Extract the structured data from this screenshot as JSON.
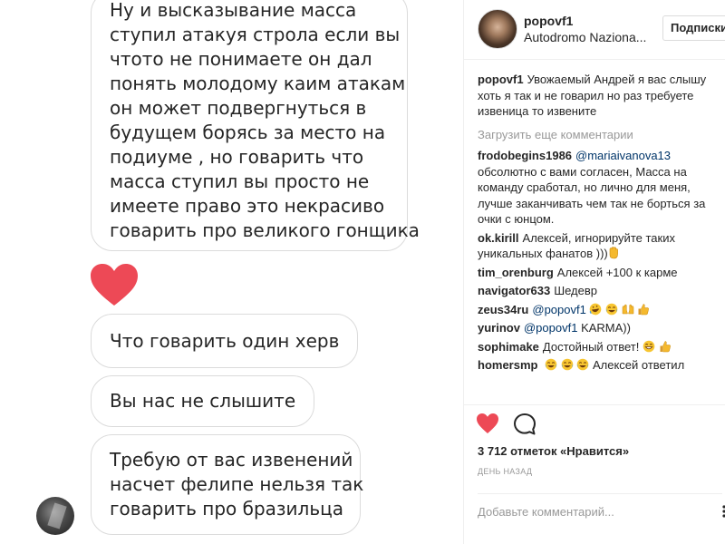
{
  "dm": {
    "message_1": [
      "Ну и высказывание масса",
      "ступил атакуя строла если вы",
      "чтото не понимаете он дал",
      "понять молодому каим атакам",
      "он может подвергнуться в",
      "будущем борясь за место на",
      "подиуме , но говарить что",
      "масса ступил вы просто не",
      "имеете право это некрасиво",
      "говарить про великого гонщика"
    ],
    "message_2": "Что говарить один херв",
    "message_3": "Вы нас не слышите",
    "message_4": [
      "Требую от вас извенений",
      "насчет фелипе нельзя так",
      "говарить про бразильца"
    ],
    "heart_color": "#ed4956"
  },
  "post": {
    "author": "popovf1",
    "location": "Autodromo Naziona...",
    "follow_label": "Подписки",
    "caption": {
      "user": "popovf1",
      "text": "Увожаемый Андрей я вас слышу хоть я так и не говарил но раз требуете извеница то извените"
    },
    "load_more": "Загрузить еще комментарии",
    "comments": [
      {
        "user": "frodobegins1986",
        "mention": "@mariaivanova13",
        "text": "обсолютно с вами согласен, Масса на команду сработал, но лично для меня, лучше заканчивать чем так не борться за очки с юнцом."
      },
      {
        "user": "ok.kirill",
        "text": "Алексей, игнорируйте таких уникальных фанатов )))",
        "emojis": [
          "raised-hand-emoji"
        ]
      },
      {
        "user": "tim_orenburg",
        "text": "Алексей +100 к карме"
      },
      {
        "user": "navigator633",
        "text": "Шедевр"
      },
      {
        "user": "zeus34ru",
        "mention": "@popovf1",
        "text": "",
        "emojis": [
          "rofl-emoji",
          "tears-of-joy-emoji",
          "raising-hands-emoji",
          "thumbs-up-emoji"
        ]
      },
      {
        "user": "yurinov",
        "mention": "@popovf1",
        "text": "KARMA))"
      },
      {
        "user": "sophimake",
        "text": "Достойный ответ!",
        "emojis": [
          "grinning-emoji",
          "thumbs-up-emoji"
        ]
      },
      {
        "user": "homersmp",
        "text": "Алексей ответил",
        "emojis_before": [
          "tears-of-joy-emoji",
          "tears-of-joy-emoji",
          "tears-of-joy-emoji"
        ]
      }
    ],
    "likes": "3 712 отметок «Нравится»",
    "timestamp": "день назад",
    "comment_placeholder": "Добавьте комментарий...",
    "like_color": "#ed4956"
  }
}
